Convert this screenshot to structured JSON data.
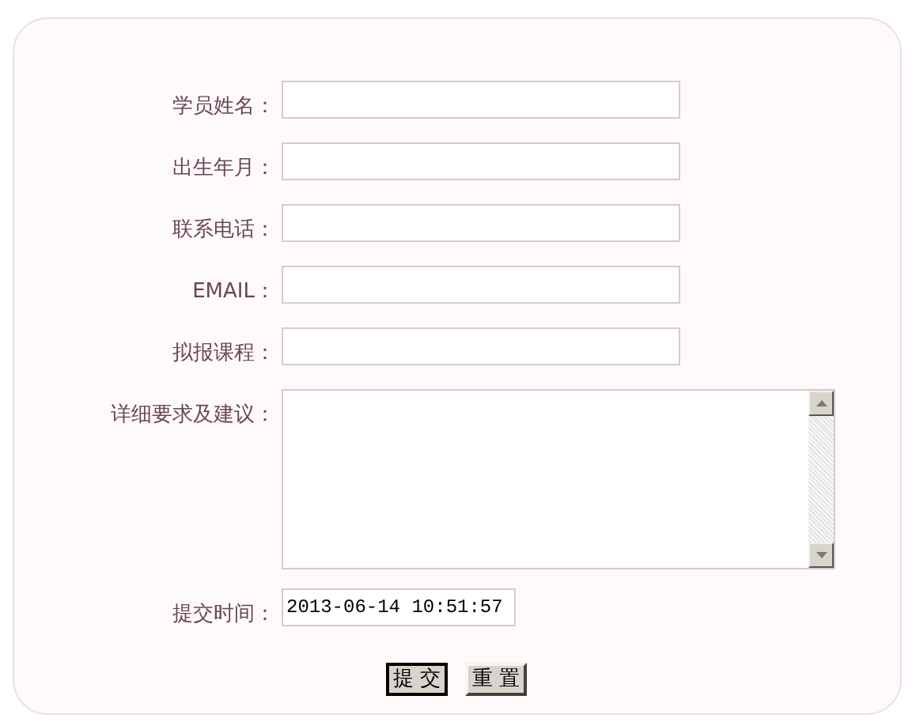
{
  "form": {
    "fields": [
      {
        "kind": "text",
        "label": "学员姓名："
      },
      {
        "kind": "text",
        "label": "出生年月："
      },
      {
        "kind": "text",
        "label": "联系电话："
      },
      {
        "kind": "text",
        "label": "EMAIL："
      },
      {
        "kind": "text",
        "label": "拟报课程："
      },
      {
        "kind": "textarea",
        "label": "详细要求及建议："
      },
      {
        "kind": "short",
        "label": "提交时间：",
        "value": "2013-06-14 10:51:57"
      }
    ],
    "buttons": [
      {
        "label": "提 交",
        "default": true
      },
      {
        "label": "重 置",
        "default": false
      }
    ]
  }
}
